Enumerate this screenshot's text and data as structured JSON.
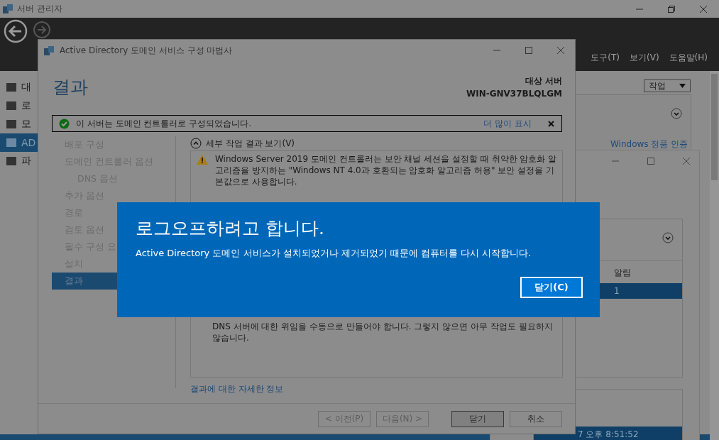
{
  "app": {
    "title": "서버 관리자",
    "menu": [
      "도구(T)",
      "보기(V)",
      "도움말(H)"
    ],
    "sidebar": [
      {
        "label": "대",
        "selected": false
      },
      {
        "label": "로",
        "selected": false
      },
      {
        "label": "모",
        "selected": false
      },
      {
        "label": "AD",
        "selected": true
      },
      {
        "label": "파",
        "selected": false
      }
    ],
    "tasks_button": "작업",
    "activation_link": "Windows 정품 인증"
  },
  "background_window": {
    "columns": [
      "알림"
    ],
    "rows": [
      {
        "cells": [
          "1"
        ],
        "selected": true
      }
    ],
    "event_time": "7 오후 8:51:52"
  },
  "wizard": {
    "title": "Active Directory 도메인 서비스 구성 마법사",
    "heading": "결과",
    "target_label": "대상 서버",
    "target_server": "WIN-GNV37BLQLGM",
    "notice": {
      "text": "이 서버는 도메인 컨트롤러로 구성되었습니다.",
      "link": "더 많이 표시"
    },
    "nav": [
      {
        "label": "배포 구성",
        "selected": false
      },
      {
        "label": "도메인 컨트롤러 옵션",
        "selected": false,
        "children": [
          {
            "label": "DNS 옵션",
            "selected": false
          }
        ]
      },
      {
        "label": "추가 옵션",
        "selected": false
      },
      {
        "label": "경로",
        "selected": false
      },
      {
        "label": "검토 옵션",
        "selected": false
      },
      {
        "label": "필수 구성 요",
        "selected": false
      },
      {
        "label": "설치",
        "selected": false
      },
      {
        "label": "결과",
        "selected": true
      }
    ],
    "details_toggle": {
      "label": "세부 작업 결과 보기(V)",
      "expanded": true
    },
    "messages": [
      {
        "kind": "warning",
        "text": "Windows Server 2019 도메인 컨트롤러는 보안 채널 세션을 설정할 때 취약한 암호화 알고리즘을 방지하는 \"Windows NT 4.0과 호환되는 암호화 알고리즘 허용\" 보안 설정을 기본값으로 사용합니다."
      },
      {
        "kind": "plain",
        "text": "DNS 서버에 대한 위임을 수동으로 만들어야 합니다. 그렇지 않으면 아무 작업도 필요하지 않습니다."
      }
    ],
    "more_link": "결과에 대한 자세한 정보",
    "buttons": [
      {
        "label": "< 이전(P)",
        "disabled": true,
        "default": false
      },
      {
        "label": "다음(N) >",
        "disabled": true,
        "default": false
      },
      {
        "label": "닫기",
        "disabled": false,
        "default": true
      },
      {
        "label": "취소",
        "disabled": false,
        "default": false
      }
    ]
  },
  "dialog": {
    "title": "로그오프하려고 합니다.",
    "message": "Active Directory 도메인 서비스가 설치되었거나 제거되었기 때문에 컴퓨터를 다시 시작합니다.",
    "button": "닫기(C)"
  }
}
